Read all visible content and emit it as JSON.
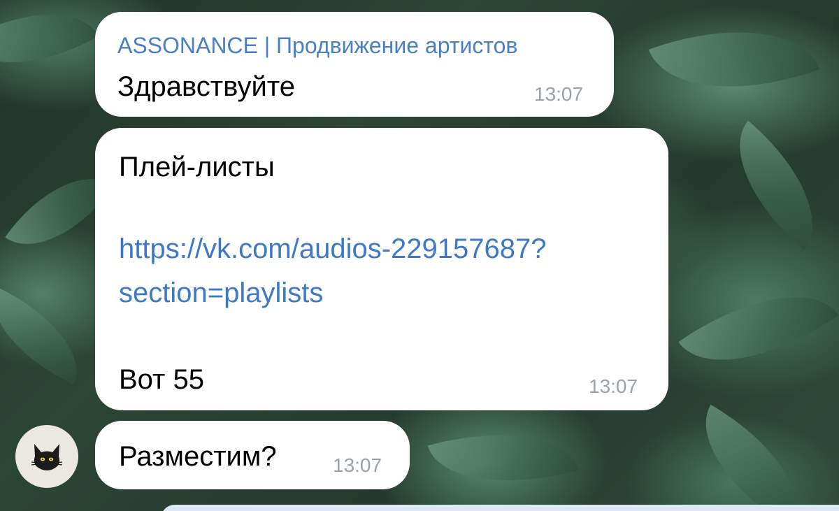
{
  "chat": {
    "messages": [
      {
        "sender": "ASSONANCE | Продвижение артистов",
        "text": "Здравствуйте",
        "time": "13:07"
      },
      {
        "text_top": "Плей-листы",
        "link_line1": " https://vk.com/audios-229157687?",
        "link_line2": "section=playlists",
        "text_bottom": "Вот 55",
        "time": "13:07"
      },
      {
        "text": "Разместим?",
        "time": "13:07"
      }
    ],
    "avatar_icon": "black-cat-icon"
  },
  "colors": {
    "sender_name": "#4a7fc4",
    "link": "#3d79c8",
    "timestamp": "#9aa1a8",
    "bubble": "#ffffff"
  }
}
